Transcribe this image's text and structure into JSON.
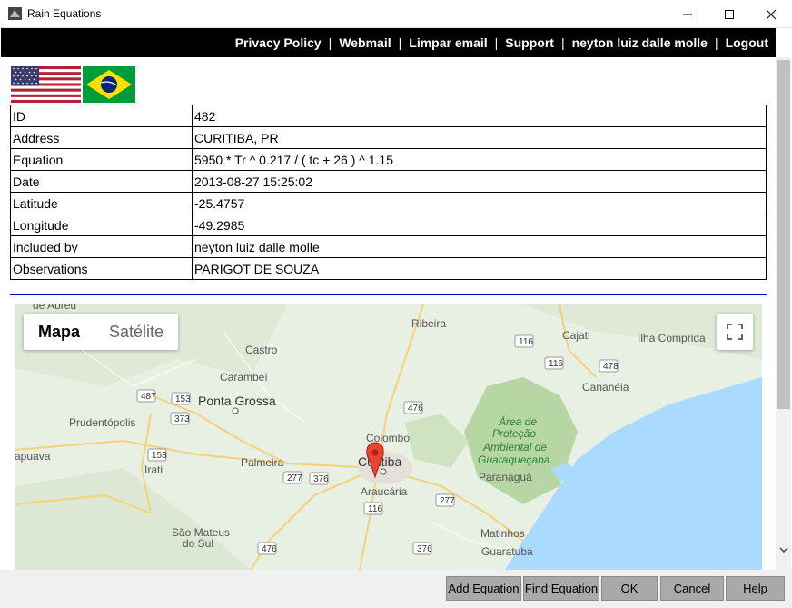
{
  "window": {
    "title": "Rain Equations"
  },
  "nav": {
    "links": [
      "Privacy Policy",
      "Webmail",
      "Limpar email",
      "Support",
      "neyton luiz dalle molle",
      "Logout"
    ],
    "separator": "|"
  },
  "flags": {
    "english": "us-flag-icon",
    "portuguese": "brazil-flag-icon"
  },
  "record": {
    "rows": [
      {
        "label": "ID",
        "value": "482"
      },
      {
        "label": "Address",
        "value": "CURITIBA, PR"
      },
      {
        "label": "Equation",
        "value": "5950 * Tr ^ 0.217 / ( tc + 26 ) ^ 1.15"
      },
      {
        "label": "Date",
        "value": "2013-08-27 15:25:02"
      },
      {
        "label": "Latitude",
        "value": "-25.4757"
      },
      {
        "label": "Longitude",
        "value": "-49.2985"
      },
      {
        "label": "Included by",
        "value": "neyton luiz dalle molle"
      },
      {
        "label": "Observations",
        "value": "PARIGOT DE SOUZA"
      }
    ]
  },
  "map": {
    "type_selected": "Mapa",
    "type_other": "Satélite",
    "places": {
      "ribeira": "Ribeira",
      "cajati": "Cajati",
      "ilha_comprida": "Ilha Comprida",
      "castro": "Castro",
      "carambei": "Carambeí",
      "cananeia": "Cananéia",
      "ponta_grossa": "Ponta Grossa",
      "prudentopolis": "Prudentópolis",
      "colombo": "Colombo",
      "curitiba": "Curitiba",
      "area_1": "Área de",
      "area_2": "Proteção",
      "area_3": "Ambiental de",
      "area_4": "Guaraqueçaba",
      "japuava": "apuava",
      "irati": "Irati",
      "palmeira": "Palmeira",
      "paranagua": "Paranaguá",
      "araucaria": "Araucária",
      "sao_mateus_1": "São Mateus",
      "sao_mateus_2": "do Sul",
      "matinhos": "Matinhos",
      "guaratuba": "Guaratuba",
      "abreu": "de Abreu"
    },
    "shields": [
      "487",
      "153",
      "373",
      "153",
      "476",
      "277",
      "376",
      "277",
      "116",
      "116",
      "478",
      "476",
      "376",
      "116"
    ]
  },
  "buttons": {
    "add": "Add Equation",
    "find": "Find Equation",
    "ok": "OK",
    "cancel": "Cancel",
    "help": "Help"
  }
}
